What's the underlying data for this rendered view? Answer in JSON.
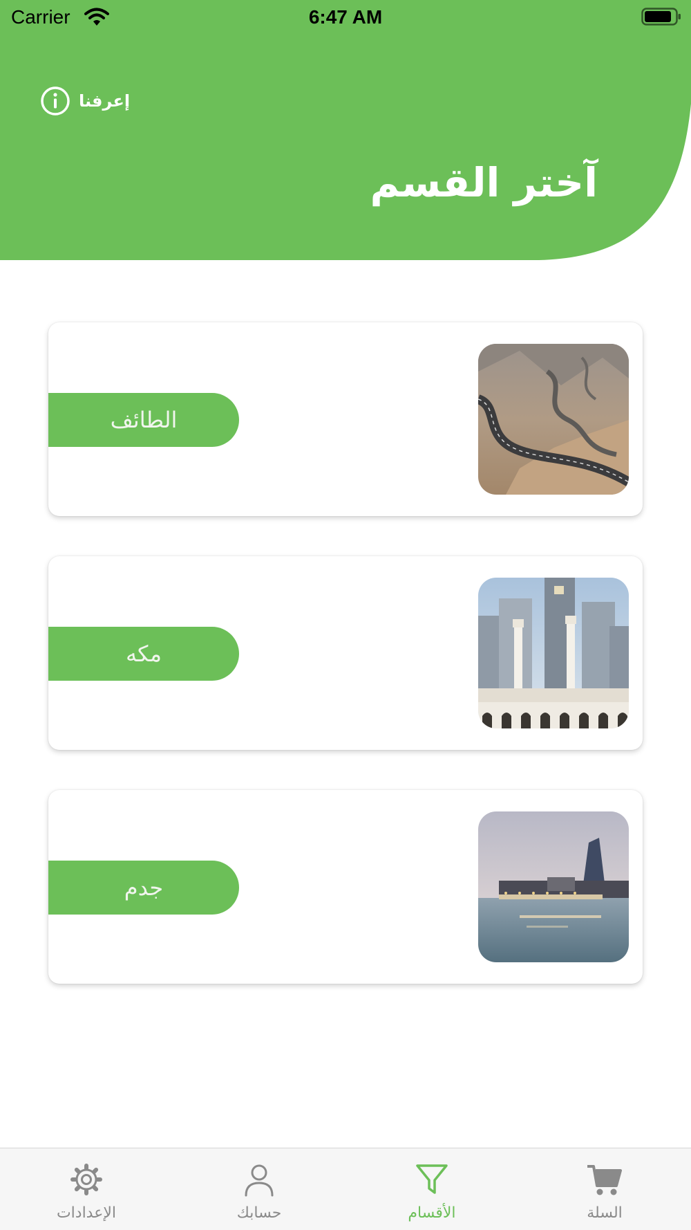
{
  "theme": {
    "accent": "#6cbf58",
    "card_label_color": "#f1f5ee",
    "tab_inactive": "#8a8a8a",
    "tab_active": "#6cbf58"
  },
  "status_bar": {
    "carrier": "Carrier",
    "time": "6:47 AM",
    "icons": [
      "wifi-icon",
      "battery-icon"
    ]
  },
  "header": {
    "about_label": "إعرفنا",
    "about_icon": "info-icon",
    "title": "آختر القسم"
  },
  "categories": [
    {
      "label": "الطائف",
      "image": "mountain-road-photo"
    },
    {
      "label": "مكه",
      "image": "clock-tower-photo"
    },
    {
      "label": "جدم",
      "image": "waterfront-photo"
    }
  ],
  "tabbar": {
    "tabs": [
      {
        "label": "الإعدادات",
        "icon": "gear-icon",
        "active": false
      },
      {
        "label": "حسابك",
        "icon": "user-icon",
        "active": false
      },
      {
        "label": "الأقسام",
        "icon": "filter-icon",
        "active": true
      },
      {
        "label": "السلة",
        "icon": "cart-icon",
        "active": false
      }
    ]
  }
}
